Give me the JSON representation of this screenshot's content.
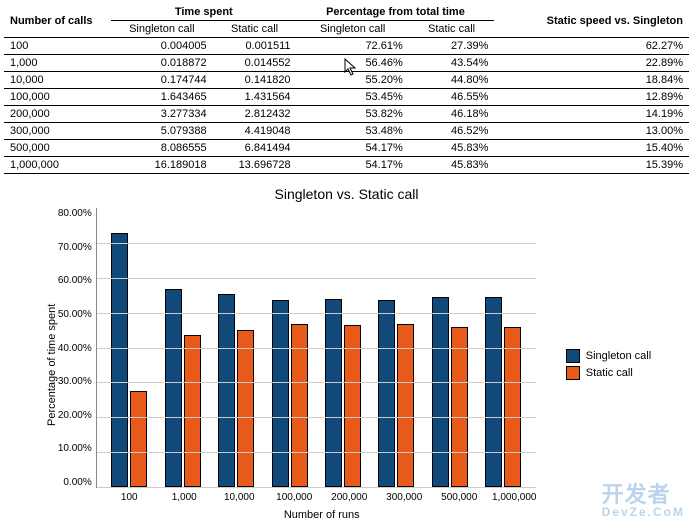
{
  "table": {
    "headers": {
      "calls": "Number of calls",
      "time_spent": "Time spent",
      "pct_total": "Percentage from total time",
      "static_vs_singleton": "Static speed vs. Singleton",
      "singleton_call": "Singleton call",
      "static_call": "Static call"
    },
    "rows": [
      {
        "calls": "100",
        "t_singleton": "0.004005",
        "t_static": "0.001511",
        "p_singleton": "72.61%",
        "p_static": "27.39%",
        "speed": "62.27%"
      },
      {
        "calls": "1,000",
        "t_singleton": "0.018872",
        "t_static": "0.014552",
        "p_singleton": "56.46%",
        "p_static": "43.54%",
        "speed": "22.89%"
      },
      {
        "calls": "10,000",
        "t_singleton": "0.174744",
        "t_static": "0.141820",
        "p_singleton": "55.20%",
        "p_static": "44.80%",
        "speed": "18.84%"
      },
      {
        "calls": "100,000",
        "t_singleton": "1.643465",
        "t_static": "1.431564",
        "p_singleton": "53.45%",
        "p_static": "46.55%",
        "speed": "12.89%"
      },
      {
        "calls": "200,000",
        "t_singleton": "3.277334",
        "t_static": "2.812432",
        "p_singleton": "53.82%",
        "p_static": "46.18%",
        "speed": "14.19%"
      },
      {
        "calls": "300,000",
        "t_singleton": "5.079388",
        "t_static": "4.419048",
        "p_singleton": "53.48%",
        "p_static": "46.52%",
        "speed": "13.00%"
      },
      {
        "calls": "500,000",
        "t_singleton": "8.086555",
        "t_static": "6.841494",
        "p_singleton": "54.17%",
        "p_static": "45.83%",
        "speed": "15.40%"
      },
      {
        "calls": "1,000,000",
        "t_singleton": "16.189018",
        "t_static": "13.696728",
        "p_singleton": "54.17%",
        "p_static": "45.83%",
        "speed": "15.39%"
      }
    ]
  },
  "chart_data": {
    "type": "bar",
    "title": "Singleton vs. Static call",
    "xlabel": "Number of runs",
    "ylabel": "Percentage of time spent",
    "ylim": [
      0,
      80
    ],
    "yticks": [
      "0.00%",
      "10.00%",
      "20.00%",
      "30.00%",
      "40.00%",
      "50.00%",
      "60.00%",
      "70.00%",
      "80.00%"
    ],
    "categories": [
      "100",
      "1,000",
      "10,000",
      "100,000",
      "200,000",
      "300,000",
      "500,000",
      "1,000,000"
    ],
    "series": [
      {
        "name": "Singleton call",
        "color": "#114a7a",
        "values": [
          72.61,
          56.46,
          55.2,
          53.45,
          53.82,
          53.48,
          54.17,
          54.17
        ]
      },
      {
        "name": "Static call",
        "color": "#e85a1a",
        "values": [
          27.39,
          43.54,
          44.8,
          46.55,
          46.18,
          46.52,
          45.83,
          45.83
        ]
      }
    ]
  },
  "watermark": {
    "line1": "开发者",
    "line2": "DevZe.CoM"
  }
}
